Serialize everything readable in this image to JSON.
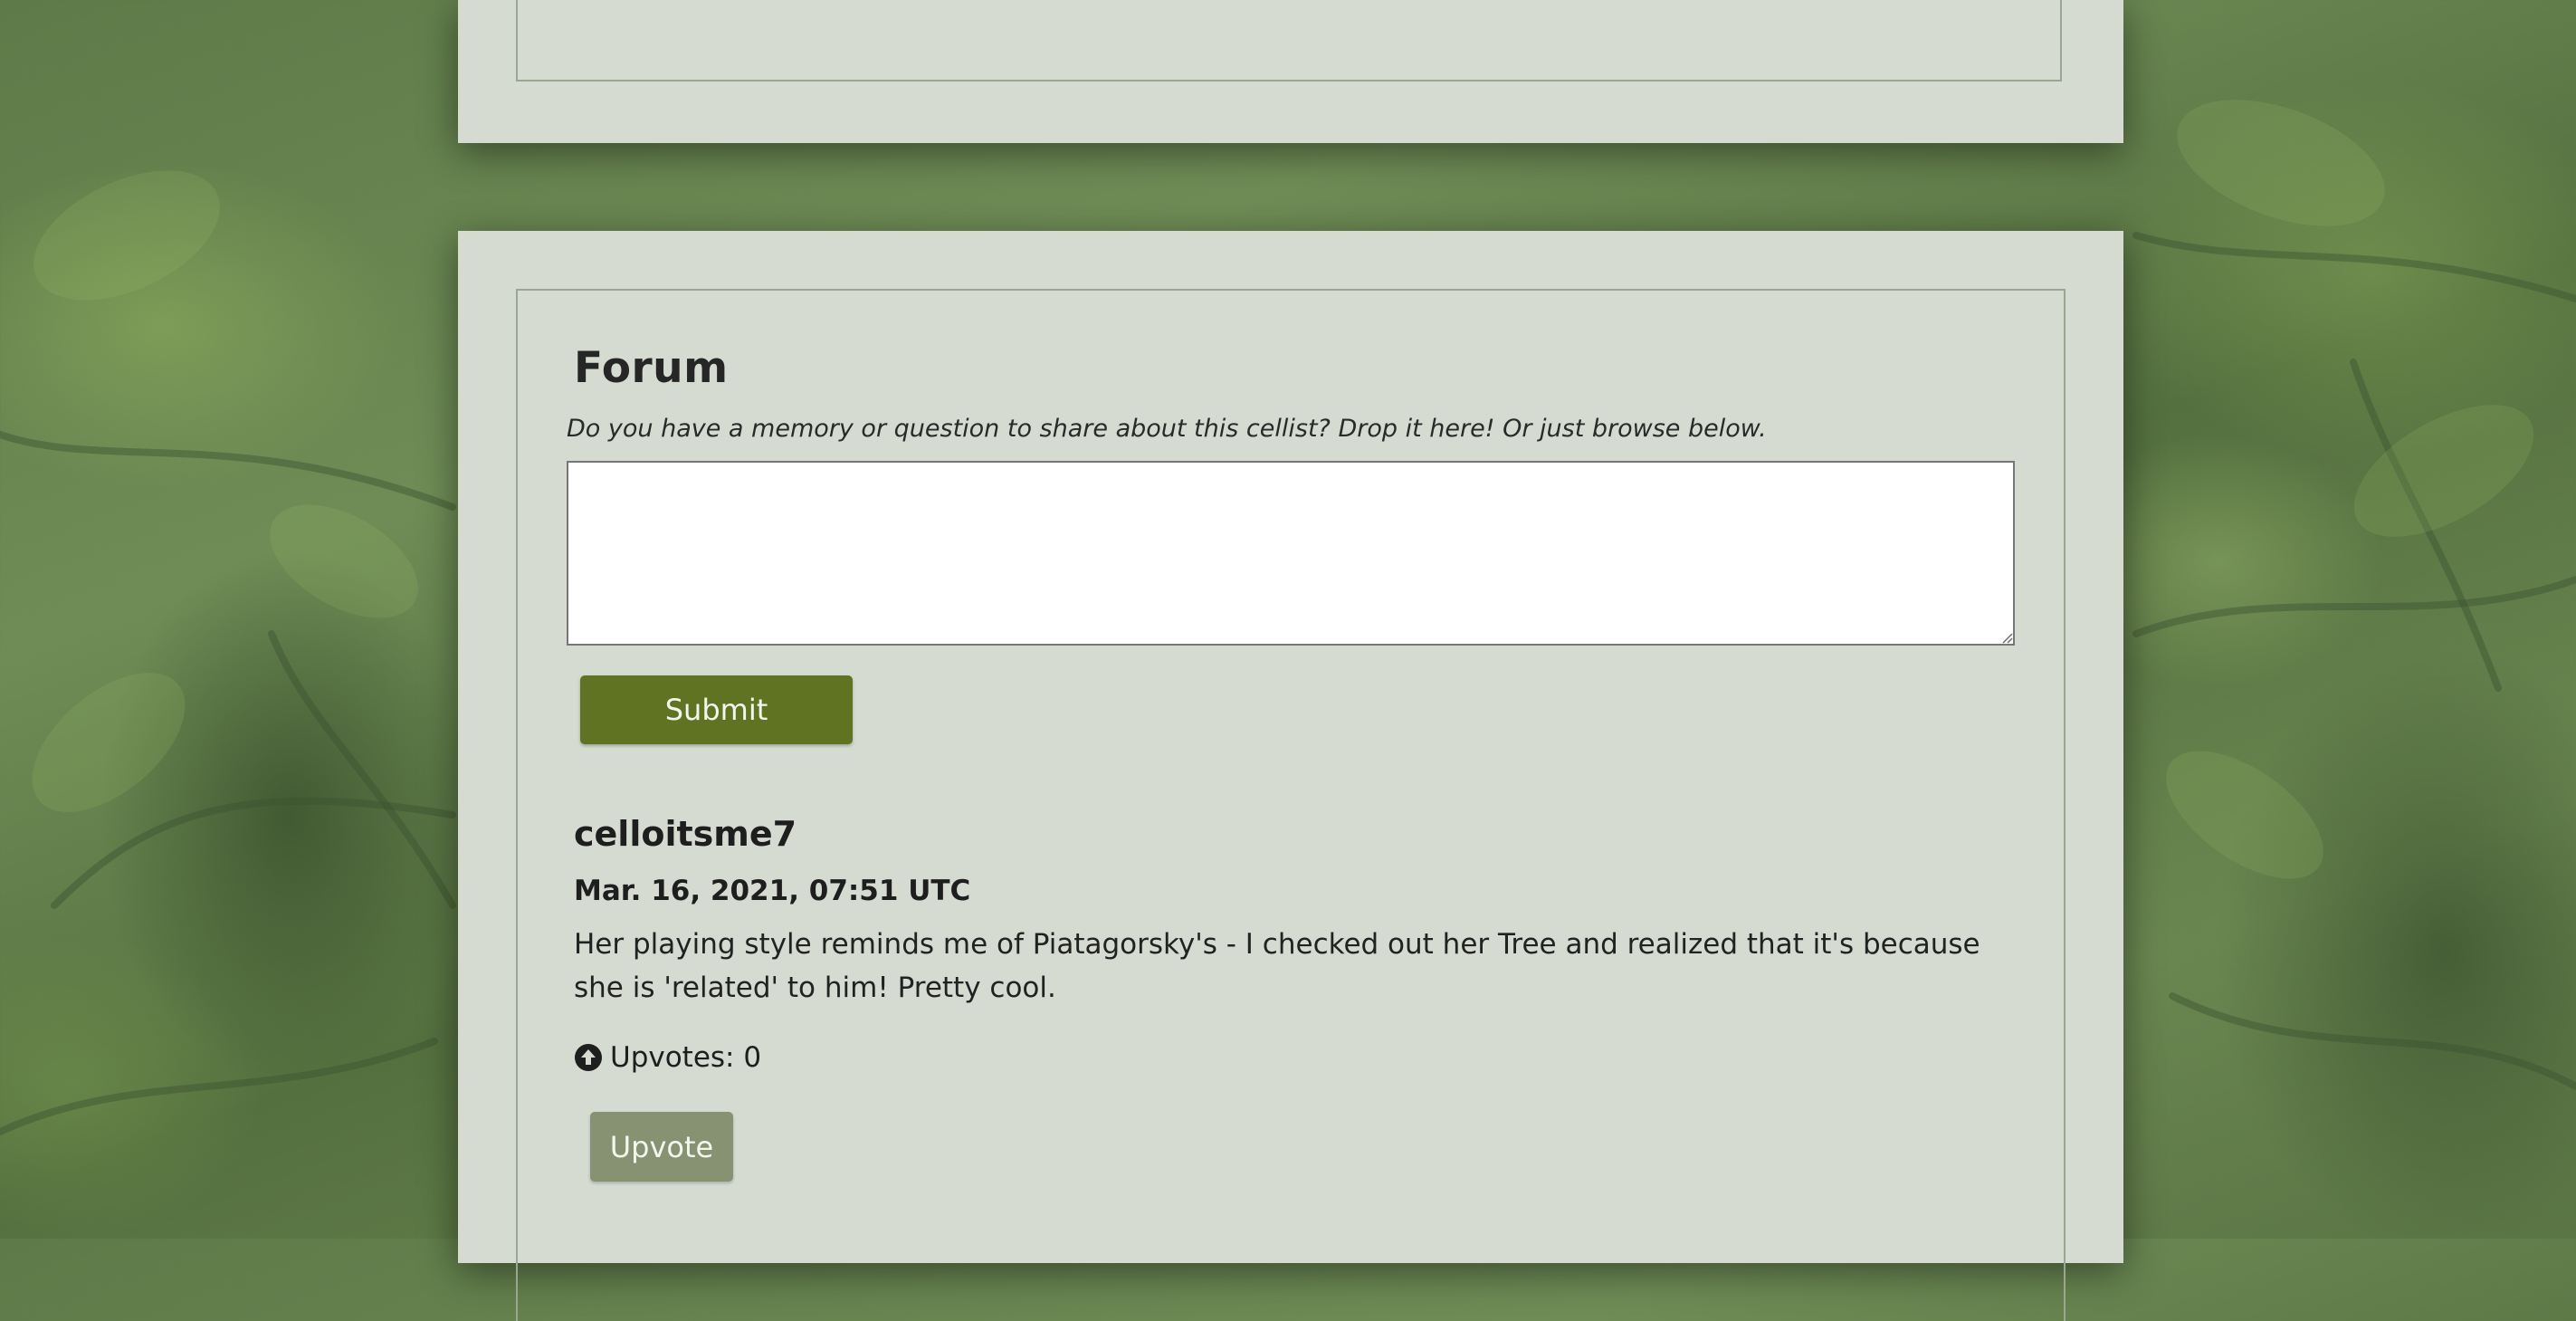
{
  "forum": {
    "title": "Forum",
    "prompt": "Do you have a memory or question to share about this cellist? Drop it here! Or just browse below.",
    "textarea_value": "",
    "submit_label": "Submit"
  },
  "posts": [
    {
      "username": "celloitsme7",
      "date": "Mar. 16, 2021, 07:51 UTC",
      "body": "Her playing style reminds me of Piatagorsky's - I checked out her Tree and realized that it's because she is 'related' to him! Pretty cool.",
      "upvotes_text": "Upvotes: 0",
      "upvote_icon": "arrow-circle-up-icon",
      "upvote_label": "Upvote"
    }
  ],
  "colors": {
    "submit_button": "#5f7323",
    "upvote_button": "#869272",
    "panel": "#d5dbd1"
  }
}
